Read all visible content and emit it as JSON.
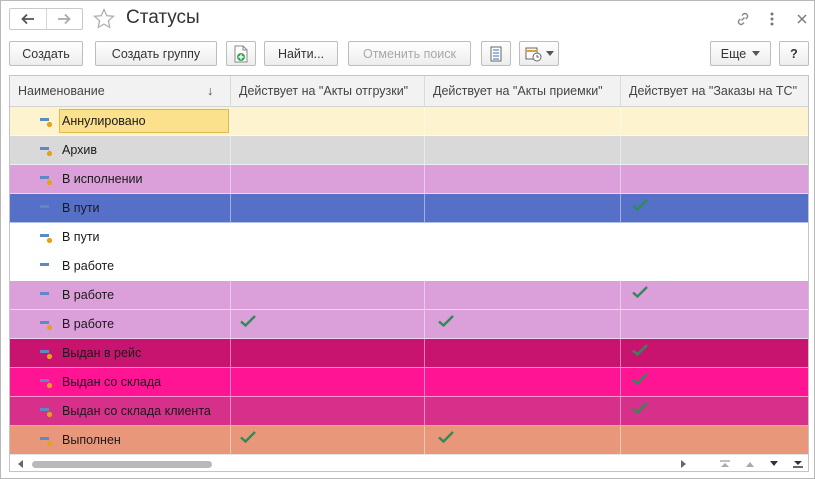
{
  "window": {
    "title": "Статусы"
  },
  "toolbar": {
    "create_label": "Создать",
    "create_group_label": "Создать группу",
    "find_label": "Найти...",
    "cancel_search_label": "Отменить поиск",
    "more_label": "Еще",
    "help_label": "?"
  },
  "table": {
    "columns": [
      {
        "label": "Наименование"
      },
      {
        "label": "Действует на \"Акты отгрузки\""
      },
      {
        "label": "Действует на \"Акты приемки\""
      },
      {
        "label": "Действует на \"Заказы на ТС\""
      }
    ],
    "sort_indicator": "↓",
    "rows": [
      {
        "name": "Аннулировано",
        "color": "#fdf4cf",
        "checks": [
          false,
          false,
          false
        ],
        "selected": true,
        "marker": true
      },
      {
        "name": "Архив",
        "color": "#d9d9d9",
        "checks": [
          false,
          false,
          false
        ],
        "selected": false,
        "marker": true
      },
      {
        "name": "В исполнении",
        "color": "#dba0d9",
        "checks": [
          false,
          false,
          false
        ],
        "selected": false,
        "marker": true
      },
      {
        "name": "В пути",
        "color": "#5670c8",
        "checks": [
          false,
          false,
          true
        ],
        "selected": false,
        "marker": false
      },
      {
        "name": "В пути",
        "color": "#ffffff",
        "checks": [
          false,
          false,
          false
        ],
        "selected": false,
        "marker": true
      },
      {
        "name": "В работе",
        "color": "#ffffff",
        "checks": [
          false,
          false,
          false
        ],
        "selected": false,
        "marker": false
      },
      {
        "name": "В работе",
        "color": "#dba0d9",
        "checks": [
          false,
          false,
          true
        ],
        "selected": false,
        "marker": false
      },
      {
        "name": "В работе",
        "color": "#dba0d9",
        "checks": [
          true,
          true,
          false
        ],
        "selected": false,
        "marker": true
      },
      {
        "name": "Выдан в рейс",
        "color": "#c8146e",
        "checks": [
          false,
          false,
          true
        ],
        "selected": false,
        "marker": true
      },
      {
        "name": "Выдан со склада",
        "color": "#ff1493",
        "checks": [
          false,
          false,
          true
        ],
        "selected": false,
        "marker": true
      },
      {
        "name": "Выдан со склада клиента",
        "color": "#d6308a",
        "checks": [
          false,
          false,
          true
        ],
        "selected": false,
        "marker": true
      },
      {
        "name": "Выполнен",
        "color": "#e8977a",
        "checks": [
          true,
          true,
          false
        ],
        "selected": false,
        "marker": true
      }
    ]
  },
  "colors": {
    "check": "#2e8b57",
    "row_icon_bar": "#5b8ac6",
    "row_icon_dot": "#e5a11a"
  }
}
